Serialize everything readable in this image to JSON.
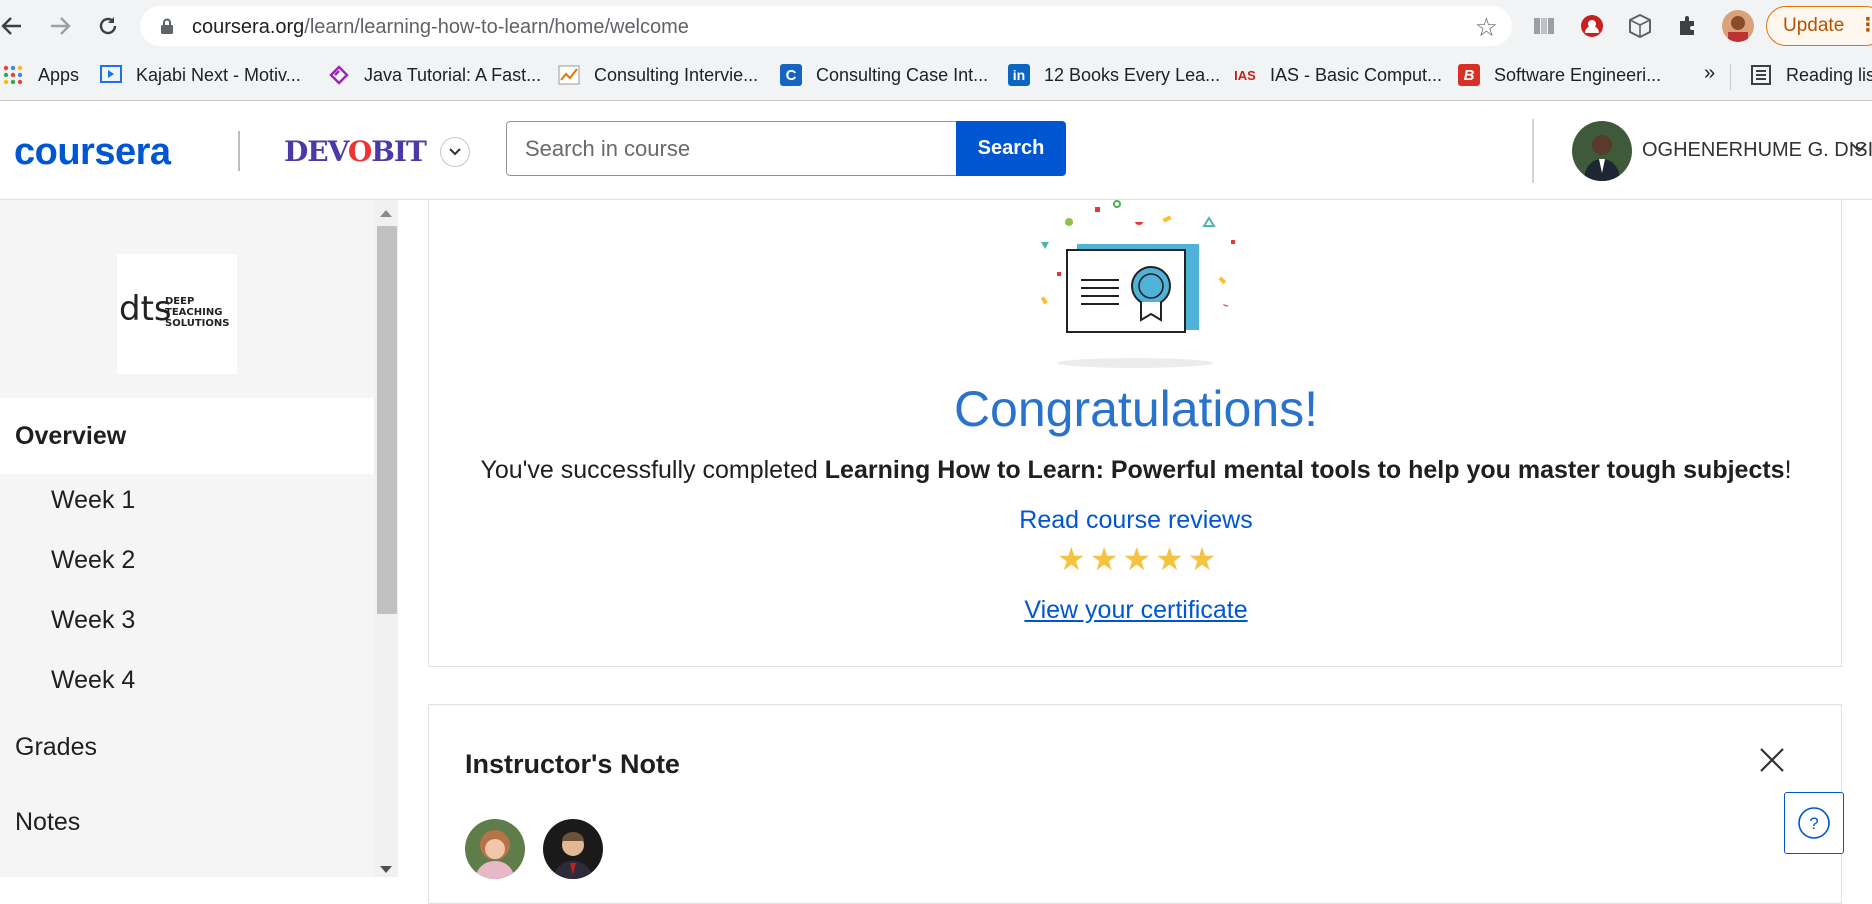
{
  "browser": {
    "url_host": "coursera.org",
    "url_path": "/learn/learning-how-to-learn/home/welcome",
    "update_label": "Update",
    "bookmarks": [
      {
        "label": "Apps"
      },
      {
        "label": "Kajabi Next - Motiv..."
      },
      {
        "label": "Java Tutorial: A Fast..."
      },
      {
        "label": "Consulting Intervie..."
      },
      {
        "label": "Consulting Case Int..."
      },
      {
        "label": "12 Books Every Lea..."
      },
      {
        "label": "IAS - Basic Comput..."
      },
      {
        "label": "Software Engineeri..."
      }
    ],
    "more_bookmarks": "»",
    "reading_list": "Reading list"
  },
  "header": {
    "logo_text": "coursera",
    "partner_text_a": "DEV",
    "partner_text_o": "O",
    "partner_text_b": "BIT",
    "search_placeholder": "Search in course",
    "search_button": "Search",
    "user_name": "OGHENERHUME G. DISI"
  },
  "sidebar": {
    "partner_logo_mark": "dts",
    "partner_logo_line1": "DEEP",
    "partner_logo_line2": "TEACHING",
    "partner_logo_line3": "SOLUTIONS",
    "overview": "Overview",
    "weeks": [
      "Week 1",
      "Week 2",
      "Week 3",
      "Week 4"
    ],
    "grades": "Grades",
    "notes": "Notes"
  },
  "congrats": {
    "title": "Congratulations!",
    "text_prefix": "You've successfully completed ",
    "course_name": "Learning How to Learn: Powerful mental tools to help you master tough subjects",
    "text_suffix": "!",
    "reviews_link": "Read course reviews",
    "rating_stars": 5,
    "certificate_link": "View your certificate"
  },
  "note": {
    "title": "Instructor's Note"
  },
  "help": {
    "label": "?"
  },
  "colors": {
    "brand_blue": "#0056d2",
    "congrats_blue": "#2a73cc",
    "star_gold": "#f5c242"
  }
}
